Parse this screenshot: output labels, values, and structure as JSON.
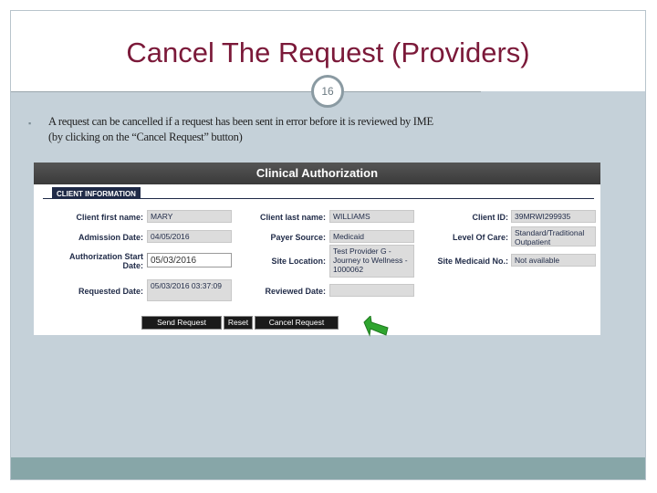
{
  "slide": {
    "title": "Cancel The Request (Providers)",
    "page_number": "16",
    "bullet_symbol": "▪",
    "body_text_line1": "A request can be cancelled if a request has been sent in error before it is reviewed by IME",
    "body_text_line2": "(by clicking on the “Cancel Request” button)"
  },
  "form": {
    "header": "Clinical Authorization",
    "tab": "CLIENT INFORMATION",
    "client_first_name_label": "Client first name:",
    "client_first_name": "MARY",
    "client_last_name_label": "Client last name:",
    "client_last_name": "WILLIAMS",
    "client_id_label": "Client ID:",
    "client_id": "39MRWI299935",
    "admission_date_label": "Admission Date:",
    "admission_date": "04/05/2016",
    "payer_source_label": "Payer Source:",
    "payer_source": "Medicaid",
    "level_of_care_label": "Level Of Care:",
    "level_of_care": "Standard/Traditional Outpatient",
    "auth_start_label_1": "Authorization Start",
    "auth_start_label_2": "Date:",
    "auth_start_date": "05/03/2016",
    "site_location_label": "Site Location:",
    "site_location": "Test Provider G - Journey to Wellness - 1000062",
    "site_medicaid_label": "Site Medicaid No.:",
    "site_medicaid": "Not available",
    "requested_date_label": "Requested Date:",
    "requested_date": "05/03/2016 03:37:09",
    "reviewed_date_label": "Reviewed Date:",
    "reviewed_date": "",
    "send_request": "Send Request",
    "reset": "Reset",
    "cancel_request": "Cancel Request"
  },
  "colors": {
    "title": "#7b1939",
    "slide_bg": "#c5d1d9",
    "footer": "#87a6a8",
    "form_label": "#1f2a47",
    "arrow": "#2fa52f"
  }
}
